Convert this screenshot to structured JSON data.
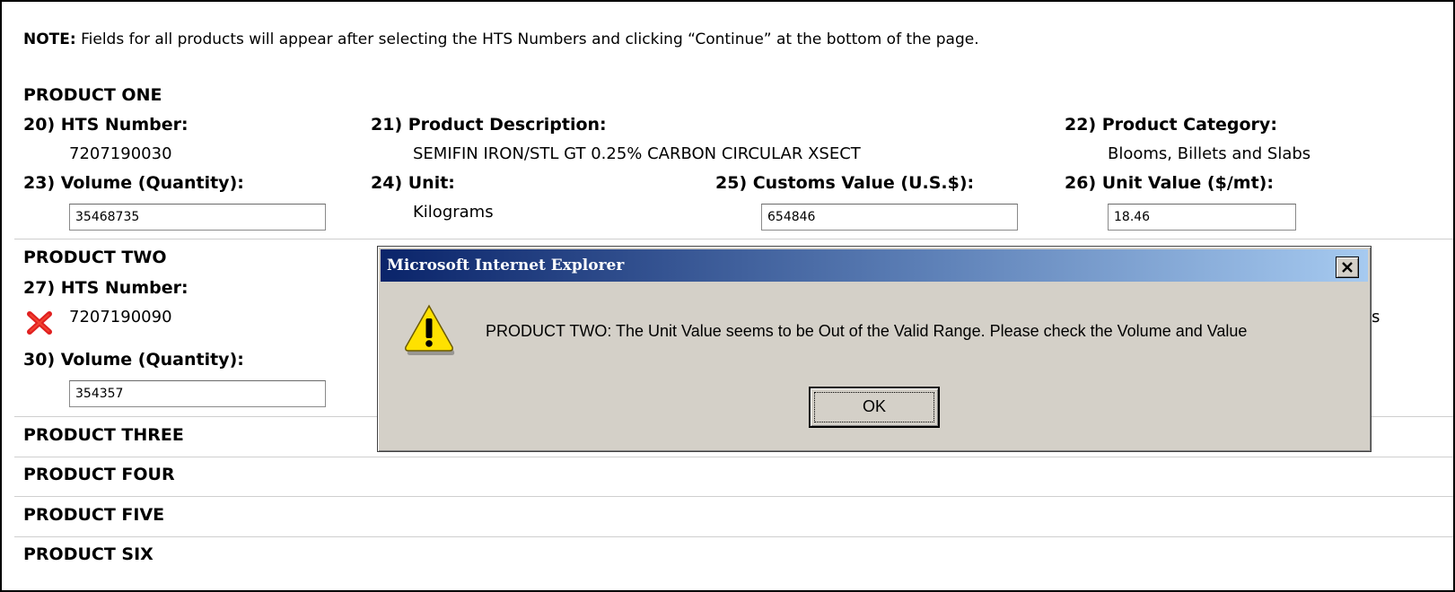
{
  "note": {
    "label": "NOTE:",
    "text": "Fields for all products will appear after selecting the HTS Numbers and clicking “Continue” at the bottom of the page."
  },
  "product_one": {
    "title": "PRODUCT ONE",
    "hts_label": "20) HTS Number:",
    "hts_value": "7207190030",
    "desc_label": "21) Product Description:",
    "desc_value": "SEMIFIN IRON/STL GT 0.25% CARBON CIRCULAR XSECT",
    "category_label": "22) Product Category:",
    "category_value": "Blooms, Billets and Slabs",
    "volume_label": "23) Volume (Quantity):",
    "volume_value": "35468735",
    "unit_label": "24) Unit:",
    "unit_value": "Kilograms",
    "customs_label": "25) Customs Value (U.S.$):",
    "customs_value": "654846",
    "unit_value_label": "26) Unit Value ($/mt):",
    "unit_value_value": "18.46"
  },
  "product_two": {
    "title": "PRODUCT TWO",
    "hts_label": "27) HTS Number:",
    "hts_value": "7207190090",
    "volume_label": "30) Volume (Quantity):",
    "volume_value": "354357",
    "partial_category_suffix": "s"
  },
  "other_products": [
    "PRODUCT THREE",
    "PRODUCT FOUR",
    "PRODUCT FIVE",
    "PRODUCT SIX"
  ],
  "dialog": {
    "title": "Microsoft Internet Explorer",
    "close_symbol": "×",
    "message": "PRODUCT TWO: The Unit Value seems to be Out of the Valid Range. Please check the Volume and Value",
    "ok_label": "OK"
  },
  "colors": {
    "titlebar_start": "#0a246a",
    "titlebar_end": "#a6caf0",
    "dialog_face": "#d4d0c8",
    "error_red": "#e02020",
    "warning_yellow": "#ffe100"
  },
  "icons": [
    "error-x-icon",
    "warning-icon",
    "close-icon"
  ]
}
